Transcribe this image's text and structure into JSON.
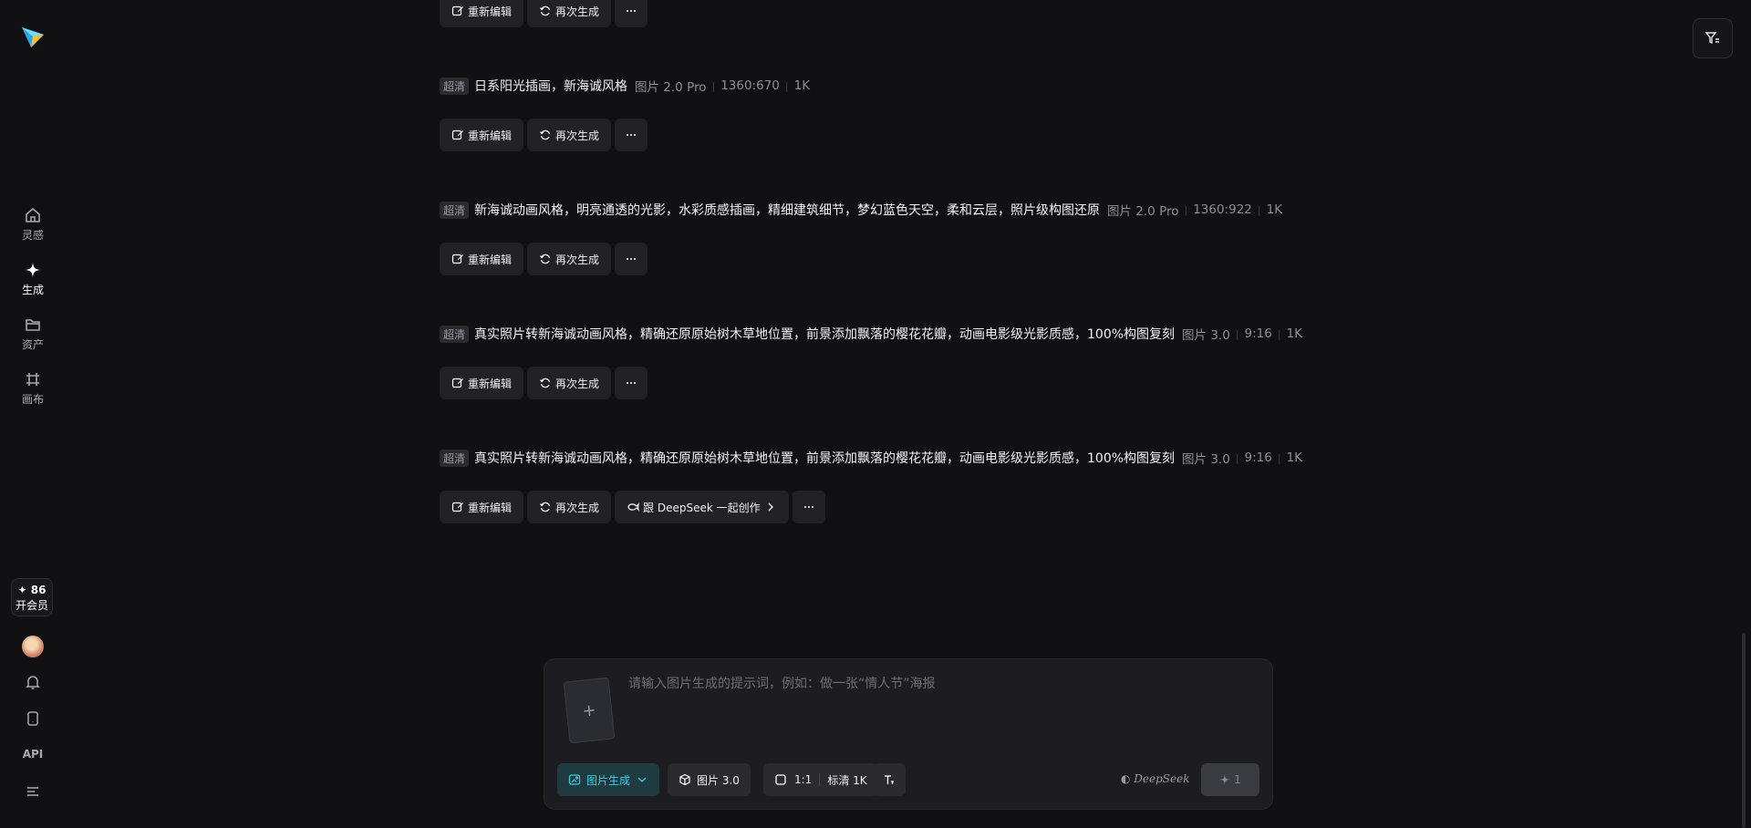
{
  "sidebar": {
    "nav": [
      {
        "label": "灵感",
        "icon": "home-icon"
      },
      {
        "label": "生成",
        "icon": "sparkle-icon"
      },
      {
        "label": "资产",
        "icon": "folder-icon"
      },
      {
        "label": "画布",
        "icon": "canvas-icon"
      }
    ],
    "vip_points": "✦ 86",
    "vip_label": "开会员",
    "api_label": "API"
  },
  "records": [
    {
      "badge": "",
      "prompt": "",
      "model": "",
      "ratio": "",
      "res": "",
      "actions": [
        "重新编辑",
        "再次生成"
      ],
      "deepseek": ""
    },
    {
      "badge": "超清",
      "prompt": "日系阳光插画，新海诚风格",
      "model": "图片 2.0 Pro",
      "ratio": "1360:670",
      "res": "1K",
      "actions": [
        "重新编辑",
        "再次生成"
      ]
    },
    {
      "badge": "超清",
      "prompt": "新海诚动画风格，明亮通透的光影，水彩质感插画，精细建筑细节，梦幻蓝色天空，柔和云层，照片级构图还原",
      "model": "图片 2.0 Pro",
      "ratio": "1360:922",
      "res": "1K",
      "actions": [
        "重新编辑",
        "再次生成"
      ]
    },
    {
      "badge": "超清",
      "prompt": "真实照片转新海诚动画风格，精确还原原始树木草地位置，前景添加飘落的樱花花瓣，动画电影级光影质感，100%构图复刻",
      "model": "图片 3.0",
      "ratio": "9:16",
      "res": "1K",
      "actions": [
        "重新编辑",
        "再次生成"
      ]
    },
    {
      "badge": "超清",
      "prompt": "真实照片转新海诚动画风格，精确还原原始树木草地位置，前景添加飘落的樱花花瓣，动画电影级光影质感，100%构图复刻",
      "model": "图片 3.0",
      "ratio": "9:16",
      "res": "1K",
      "actions": [
        "重新编辑",
        "再次生成"
      ],
      "deepseek": "跟 DeepSeek 一起创作"
    }
  ],
  "composer": {
    "placeholder": "请输入图片生成的提示词，例如：做一张“情人节”海报",
    "upload_plus": "+",
    "mode": "图片生成",
    "model": "图片 3.0",
    "ratio": "1:1",
    "quality": "标清 1K",
    "brand": "DeepSeek",
    "send_count": "1"
  },
  "colors": {
    "accent": "#35d0e0",
    "background": "#111114",
    "button": "#222226"
  }
}
